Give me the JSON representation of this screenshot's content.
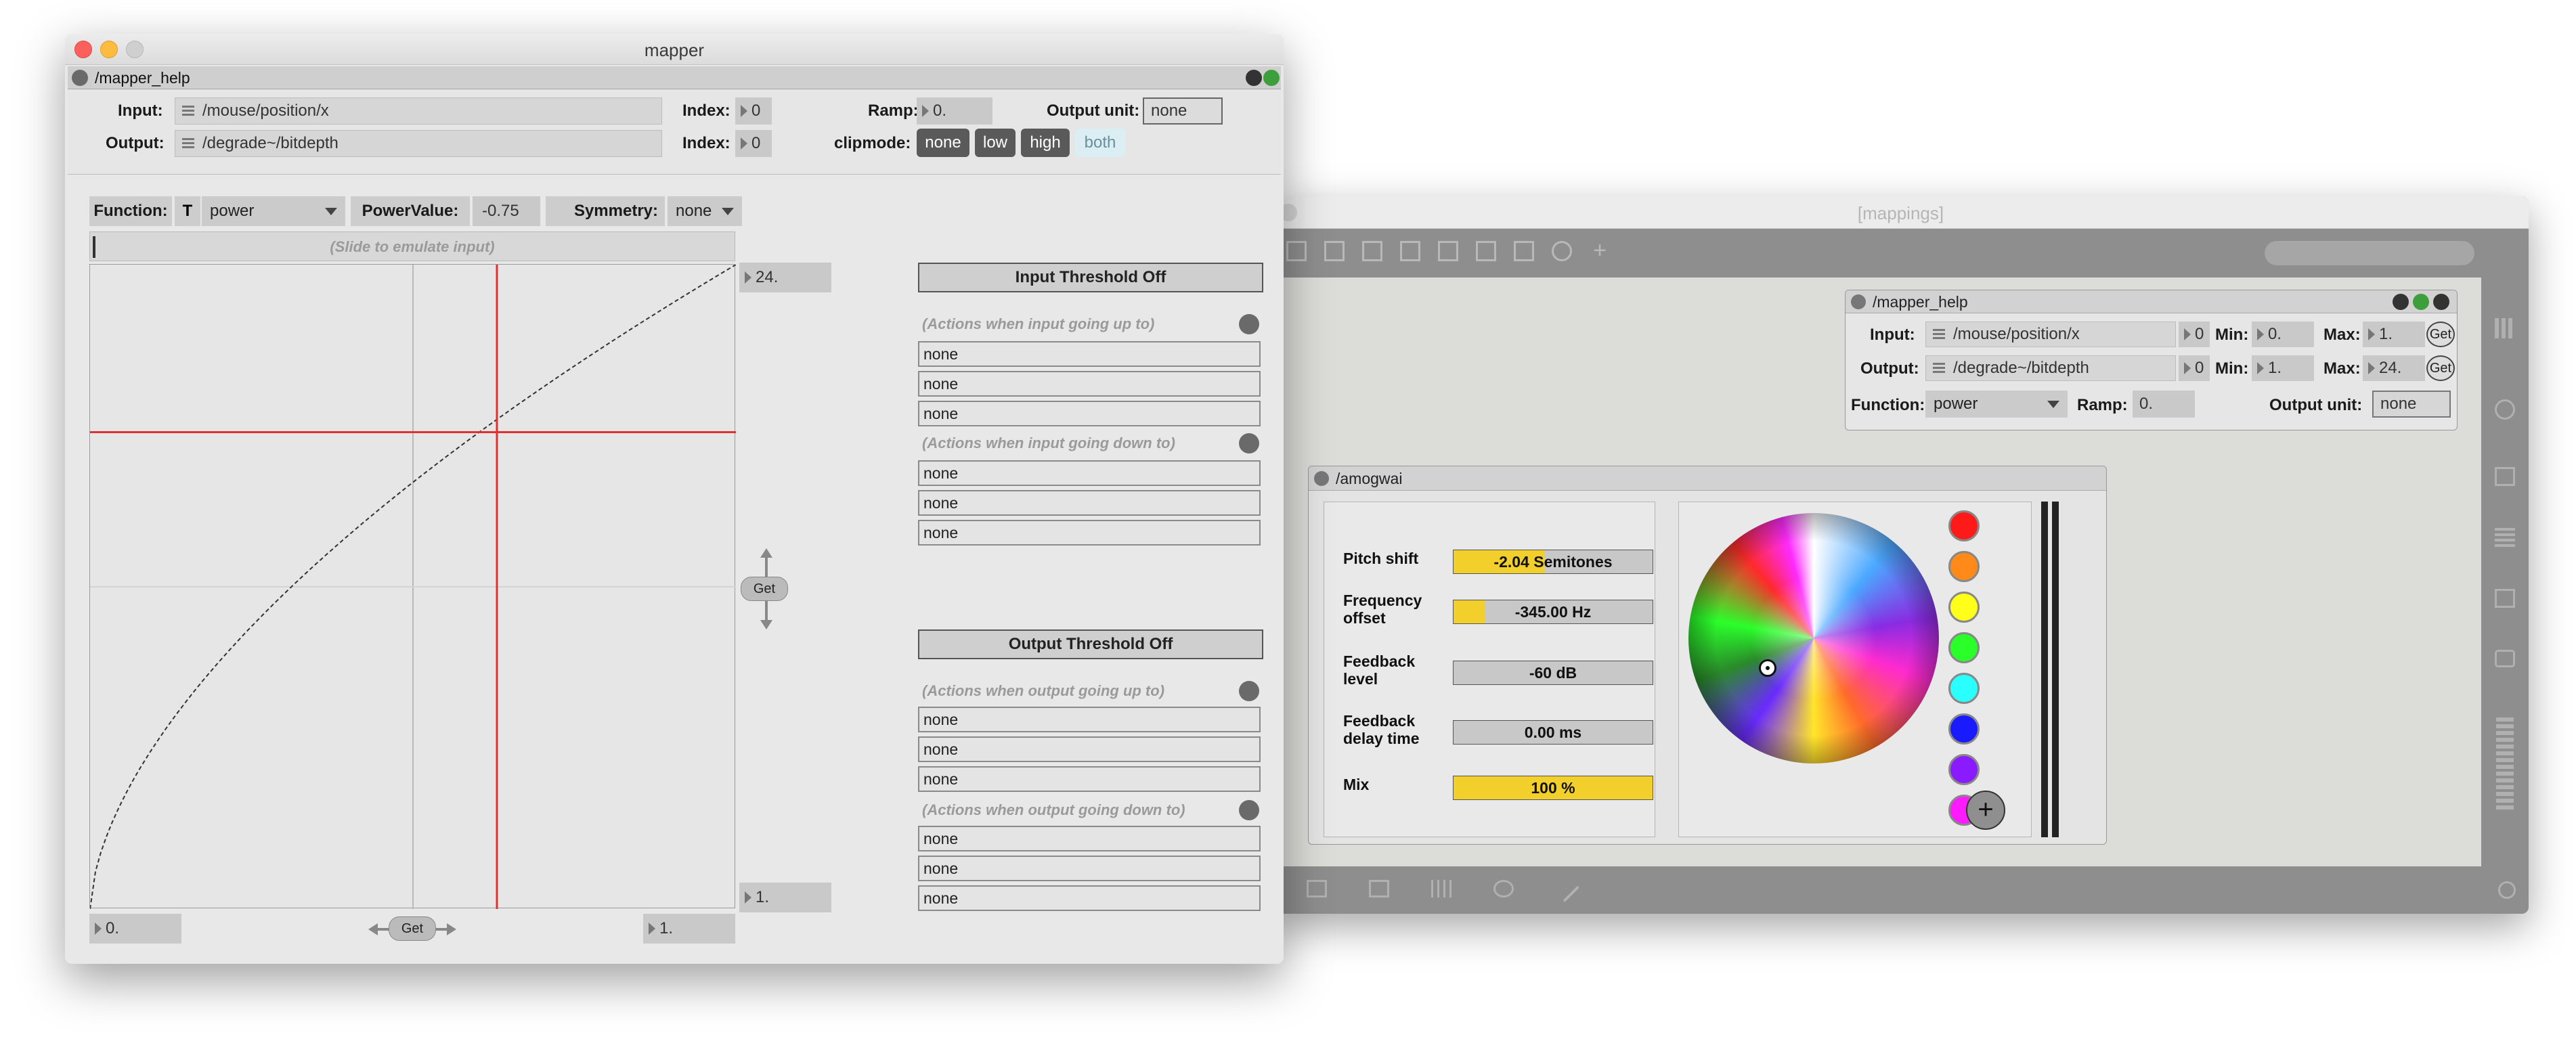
{
  "mapper_window": {
    "title": "mapper",
    "patcher_title": "/mapper_help",
    "input_label": "Input:",
    "input_value": "/mouse/position/x",
    "output_label": "Output:",
    "output_value": "/degrade~/bitdepth",
    "index_label": "Index:",
    "input_index": "0",
    "output_index": "0",
    "ramp_label": "Ramp:",
    "ramp_value": "0.",
    "output_unit_label": "Output unit:",
    "output_unit_value": "none",
    "clipmode_label": "clipmode:",
    "clipmodes": [
      "none",
      "low",
      "high",
      "both"
    ],
    "clipmode_selected": "both",
    "function_label": "Function:",
    "function_type_icon": "T",
    "function_value": "power",
    "powervalue_label": "PowerValue:",
    "powervalue_value": "-0.75",
    "symmetry_label": "Symmetry:",
    "symmetry_value": "none",
    "slide_hint": "(Slide to emulate input)",
    "out_max": "24.",
    "out_min": "1.",
    "in_min": "0.",
    "in_max": "1.",
    "get_label": "Get",
    "input_threshold": {
      "title": "Input Threshold Off",
      "up_hint": "(Actions when input going up to)",
      "up_actions": [
        "none",
        "none",
        "none"
      ],
      "down_hint": "(Actions when input going down to)",
      "down_actions": [
        "none",
        "none",
        "none"
      ]
    },
    "output_threshold": {
      "title": "Output Threshold Off",
      "up_hint": "(Actions when output going up to)",
      "up_actions": [
        "none",
        "none",
        "none"
      ],
      "down_hint": "(Actions when output going down to)",
      "down_actions": [
        "none",
        "none",
        "none"
      ]
    },
    "curve": {
      "input_marker": 0.63,
      "output_marker": 0.74
    }
  },
  "mappings_window": {
    "title": "[mappings]",
    "mapper_help": {
      "title": "/mapper_help",
      "input_label": "Input:",
      "input_value": "/mouse/position/x",
      "input_index": "0",
      "input_min_label": "Min:",
      "input_min": "0.",
      "input_max_label": "Max:",
      "input_max": "1.",
      "output_label": "Output:",
      "output_value": "/degrade~/bitdepth",
      "output_index": "0",
      "output_min_label": "Min:",
      "output_min": "1.",
      "output_max_label": "Max:",
      "output_max": "24.",
      "get_label": "Get",
      "function_label": "Function:",
      "function_value": "power",
      "ramp_label": "Ramp:",
      "ramp_value": "0.",
      "output_unit_label": "Output unit:",
      "output_unit_value": "none"
    },
    "amogwai": {
      "title": "/amogwai",
      "params": [
        {
          "label_line1": "Pitch shift",
          "label_line2": "",
          "value": "-2.04 Semitones",
          "fill": 0.46
        },
        {
          "label_line1": "Frequency",
          "label_line2": "offset",
          "value": "-345.00 Hz",
          "fill": 0.16
        },
        {
          "label_line1": "Feedback",
          "label_line2": "level",
          "value": "-60 dB",
          "fill": 0.0
        },
        {
          "label_line1": "Feedback",
          "label_line2": "delay time",
          "value": "0.00 ms",
          "fill": 0.0
        },
        {
          "label_line1": "Mix",
          "label_line2": "",
          "value": "100 %",
          "fill": 1.0
        }
      ],
      "swatches": [
        "#ff1a1a",
        "#ff8a1a",
        "#ffff1a",
        "#2aff2a",
        "#2affff",
        "#1a1aff",
        "#8a1aff",
        "#ff1aff"
      ],
      "add_label": "+"
    }
  },
  "colors": {
    "accent_yellow": "#f2cf2a",
    "curve_marker": "#e03030",
    "close": "#fc605c",
    "minimize": "#fdbc40",
    "zoom": "#cccccc"
  }
}
